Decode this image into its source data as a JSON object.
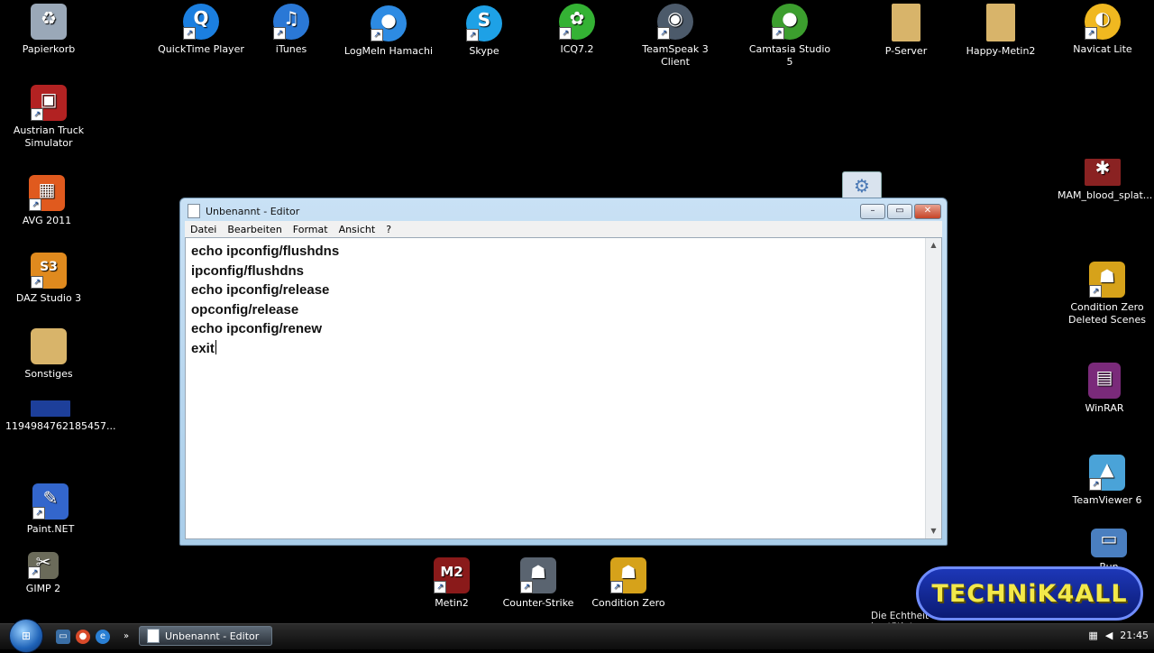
{
  "desktop": {
    "icons": [
      {
        "label": "Papierkorb",
        "icon": "recycle-bin-icon",
        "color": "#9aa8b8",
        "glyph": "♻"
      },
      {
        "label": "QuickTime Player",
        "icon": "quicktime-icon",
        "color": "#1b7fe0",
        "glyph": "Q"
      },
      {
        "label": "iTunes",
        "icon": "itunes-icon",
        "color": "#2a78d6",
        "glyph": "♫"
      },
      {
        "label": "LogMeIn Hamachi",
        "icon": "hamachi-icon",
        "color": "#2d8be3",
        "glyph": "●"
      },
      {
        "label": "Skype",
        "icon": "skype-icon",
        "color": "#1ea1e6",
        "glyph": "S"
      },
      {
        "label": "ICQ7.2",
        "icon": "icq-icon",
        "color": "#34b234",
        "glyph": "✿"
      },
      {
        "label": "TeamSpeak 3 Client",
        "icon": "teamspeak-icon",
        "color": "#4c5a6a",
        "glyph": "◉"
      },
      {
        "label": "Camtasia Studio 5",
        "icon": "camtasia-icon",
        "color": "#3c9e2e",
        "glyph": "●"
      },
      {
        "label": "P-Server",
        "icon": "folder-icon",
        "color": "#d8b46a",
        "glyph": ""
      },
      {
        "label": "Happy-Metin2",
        "icon": "folder-icon",
        "color": "#d8b46a",
        "glyph": ""
      },
      {
        "label": "Navicat Lite",
        "icon": "navicat-icon",
        "color": "#f0b820",
        "glyph": "◐"
      },
      {
        "label": "Austrian Truck Simulator",
        "icon": "truck-simulator-icon",
        "color": "#b22222",
        "glyph": "▣"
      },
      {
        "label": "AVG 2011",
        "icon": "avg-icon",
        "color": "#e05a1e",
        "glyph": "▦"
      },
      {
        "label": "DAZ Studio 3",
        "icon": "daz-studio-icon",
        "color": "#e08a1e",
        "glyph": "S3"
      },
      {
        "label": "Sonstiges",
        "icon": "folder-icon",
        "color": "#d8b46a",
        "glyph": ""
      },
      {
        "label": "1194984762185457...",
        "icon": "image-file-icon",
        "color": "#1d3f9a",
        "glyph": "▭"
      },
      {
        "label": "Paint.NET",
        "icon": "paintnet-icon",
        "color": "#3366cc",
        "glyph": "✎"
      },
      {
        "label": "GIMP 2",
        "icon": "gimp-icon",
        "color": "#6b6b5a",
        "glyph": "✂"
      },
      {
        "label": "MAM_blood_splat...",
        "icon": "image-file-icon",
        "color": "#8a2222",
        "glyph": "✱"
      },
      {
        "label": "Condition Zero Deleted Scenes",
        "icon": "condition-zero-icon",
        "color": "#d6a21a",
        "glyph": "☗"
      },
      {
        "label": "WinRAR",
        "icon": "winrar-icon",
        "color": "#7a2a7a",
        "glyph": "▤"
      },
      {
        "label": "TeamViewer 6",
        "icon": "teamviewer-icon",
        "color": "#4aa3d8",
        "glyph": "▲"
      },
      {
        "label": "Run",
        "icon": "run-icon",
        "color": "#4a7fc0",
        "glyph": "▭"
      },
      {
        "label": "Metin2",
        "icon": "metin2-icon",
        "color": "#8a1a1a",
        "glyph": "M2"
      },
      {
        "label": "Counter-Strike",
        "icon": "counter-strike-icon",
        "color": "#5a6470",
        "glyph": "☗"
      },
      {
        "label": "Condition Zero",
        "icon": "condition-zero-icon",
        "color": "#d6a21a",
        "glyph": "☗"
      }
    ]
  },
  "notepad": {
    "title": "Unbenannt - Editor",
    "menu": [
      "Datei",
      "Bearbeiten",
      "Format",
      "Ansicht",
      "?"
    ],
    "lines": [
      "echo ipconfig/flushdns",
      "ipconfig/flushdns",
      "echo ipconfig/release",
      "opconfig/release",
      "echo ipconfig/renew",
      "exit"
    ]
  },
  "taskbar": {
    "task_label": "Unbenannt - Editor",
    "clock": "21:45"
  },
  "watermark": "Die Echtheit dieser Windows-Kopie wurde noch nicht bestätigt",
  "brand": "TECHNiK4ALL"
}
